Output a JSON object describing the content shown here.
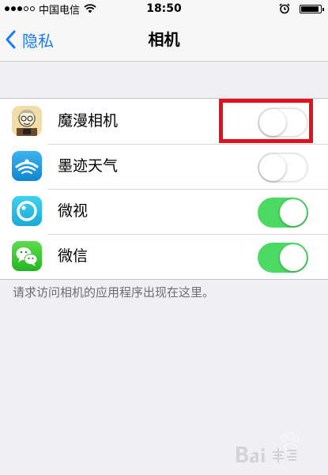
{
  "status_bar": {
    "carrier": "中国电信",
    "time": "18:50",
    "signal_bars": [
      true,
      true,
      true,
      false,
      false
    ],
    "battery_level": 0.9,
    "icons": [
      "signal-dots",
      "wifi-icon",
      "alarm-icon",
      "battery-icon"
    ]
  },
  "nav": {
    "back_label": "隐私",
    "title": "相机"
  },
  "apps": [
    {
      "name": "魔漫相机",
      "enabled": false,
      "icon": "momanxiangji-app-icon",
      "highlighted": true
    },
    {
      "name": "墨迹天气",
      "enabled": false,
      "icon": "mojitianqi-app-icon",
      "highlighted": false
    },
    {
      "name": "微视",
      "enabled": true,
      "icon": "weishi-app-icon",
      "highlighted": false
    },
    {
      "name": "微信",
      "enabled": true,
      "icon": "wechat-app-icon",
      "highlighted": false
    }
  ],
  "footer_note": "请求访问相机的应用程序出现在这里。",
  "colors": {
    "accent_blue": "#1a7cf5",
    "switch_on": "#4cd964",
    "switch_off_border": "#e5e5ea",
    "highlight_red": "#e3101e",
    "background": "#efeff4"
  }
}
